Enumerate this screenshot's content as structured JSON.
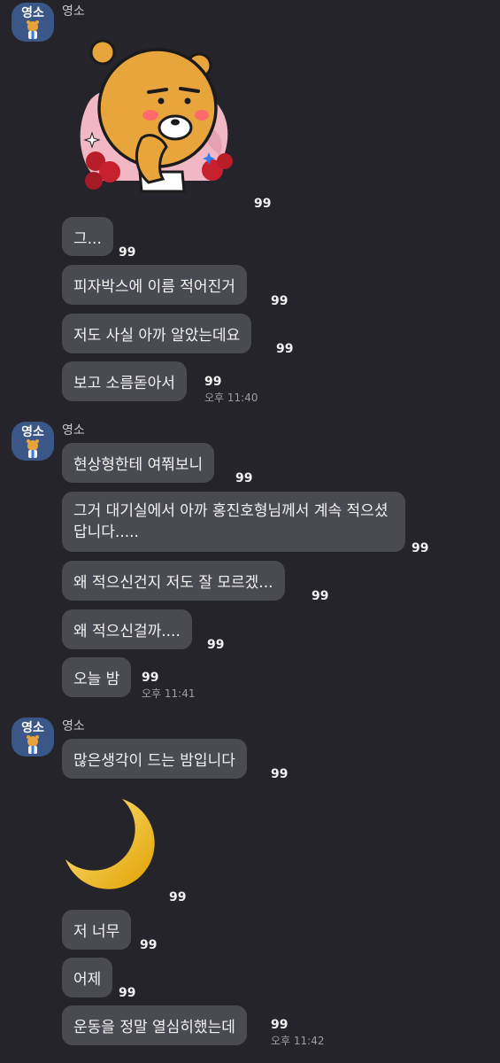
{
  "sender_name": "영소",
  "avatar_text": "영소",
  "read_count": "99",
  "colors": {
    "background": "#24242a",
    "bubble": "#4a4b52",
    "avatar": "#3b5787",
    "text": "#f2f2f2",
    "meta": "#9d9da3"
  },
  "group1": {
    "sticker": "ryan-bear-emoticon",
    "messages": [
      "그...",
      "피자박스에 이름 적어진거",
      "저도 사실 아까 알았는데요",
      "보고 소름돋아서"
    ],
    "time": "오후 11:40"
  },
  "group2": {
    "messages": [
      "현상형한테 여쭤보니",
      "그거 대기실에서 아까 홍진호형님께서 계속 적으셨답니다.....",
      "왜 적으신건지 저도 잘 모르겠...",
      "왜 적으신걸까....",
      "오늘 밤"
    ],
    "time": "오후 11:41"
  },
  "group3": {
    "messages": [
      "많은생각이 드는 밤입니다",
      "저 너무",
      "어제",
      "운동을 정말 열심히했는데"
    ],
    "sticker": "crescent-moon-emoji",
    "time": "오후 11:42"
  }
}
